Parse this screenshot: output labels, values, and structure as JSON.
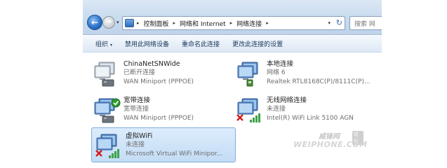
{
  "window": {
    "nav": {
      "back_glyph": "←",
      "forward_glyph": "→",
      "dropdown_glyph": "▾"
    },
    "address_bar": {
      "breadcrumbs": [
        "控制面板",
        "网络和 Internet",
        "网络连接"
      ],
      "separator": "▸",
      "dropdown_glyph": "▾",
      "refresh_glyph": "↻"
    },
    "search": {
      "placeholder": "搜索 网"
    },
    "command_bar": {
      "organize": "组织",
      "disable": "禁用此网络设备",
      "rename": "重命名此连接",
      "settings": "更改此连接的设置",
      "dropdown_glyph": "▾"
    },
    "connections": [
      {
        "name": "ChinaNetSNWide",
        "status": "已断开连接",
        "device": "WAN Miniport (PPPOE)",
        "icon": "broadband-connection-icon",
        "badge": "none"
      },
      {
        "name": "本地连接",
        "status": "网络  6",
        "device": "Realtek RTL8168C(P)/8111C(P)...",
        "icon": "ethernet-connection-icon",
        "badge": "none"
      },
      {
        "name": "宽带连接",
        "status": "宽带连接",
        "device": "WAN Miniport (PPPOE)",
        "icon": "broadband-connection-icon",
        "badge": "green-check"
      },
      {
        "name": "无线网络连接",
        "status": "未连接",
        "device": "Intel(R) WiFi Link 5100 AGN",
        "icon": "wireless-connection-icon",
        "badge": "red-x"
      },
      {
        "name": "虚拟WiFi",
        "status": "未连接",
        "device": "Microsoft Virtual WiFi Minipor...",
        "icon": "virtual-wifi-connection-icon",
        "badge": "red-x",
        "selected": true
      }
    ]
  },
  "watermark": {
    "cn": "威锋网",
    "badge": "论坛",
    "en": "WEIPHONE.COM"
  },
  "colors": {
    "selection": "#cfe3f8",
    "status_ok": "#2f9a2f",
    "status_error": "#d21c1c",
    "signal": "#3fa14a",
    "command_text": "#1e395b"
  }
}
